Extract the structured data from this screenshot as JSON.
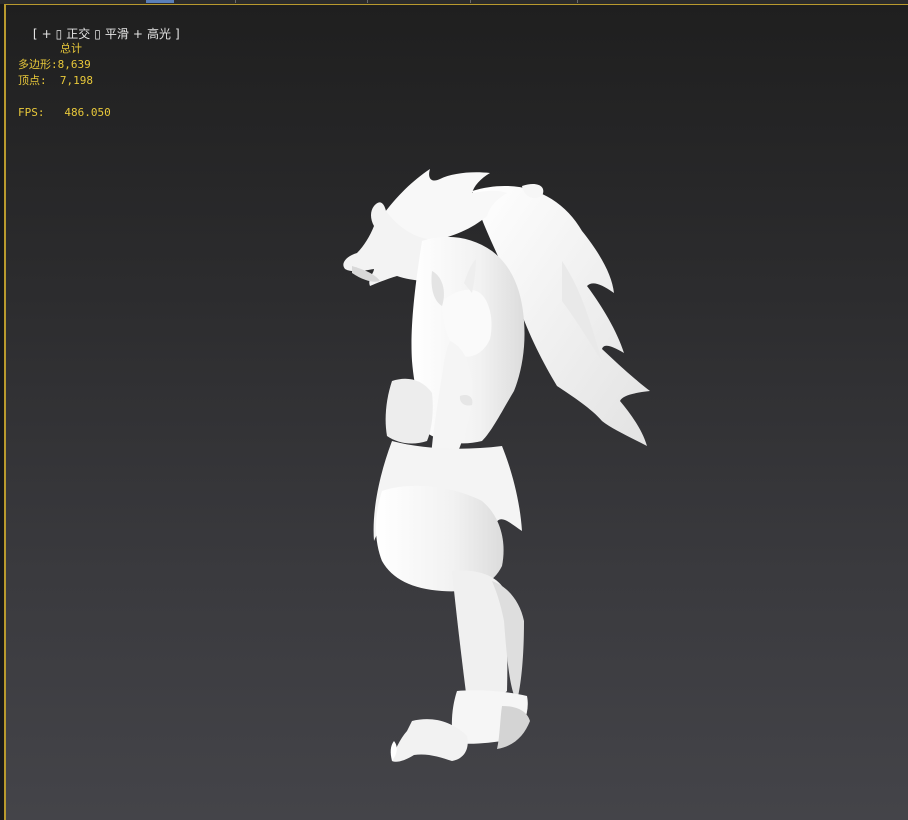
{
  "viewport": {
    "label": {
      "open_bracket": "[",
      "plus_1": "+",
      "box_1": "▯",
      "view_mode": "正交",
      "box_2": "▯",
      "shading": "平滑",
      "plus_2": "+",
      "highlight": "高光",
      "close_bracket": "]"
    },
    "border_color": "#b99a2e"
  },
  "stats": {
    "title": "总计",
    "polygons_label": "多边形:",
    "polygons_value": "8,639",
    "vertices_label": "顶点:",
    "vertices_value": "7,198",
    "fps_label": "FPS:",
    "fps_value": "486.050",
    "text_color": "#e8c83a"
  },
  "model": {
    "icon": "werewolf-model",
    "color": "#f4f4f4"
  }
}
